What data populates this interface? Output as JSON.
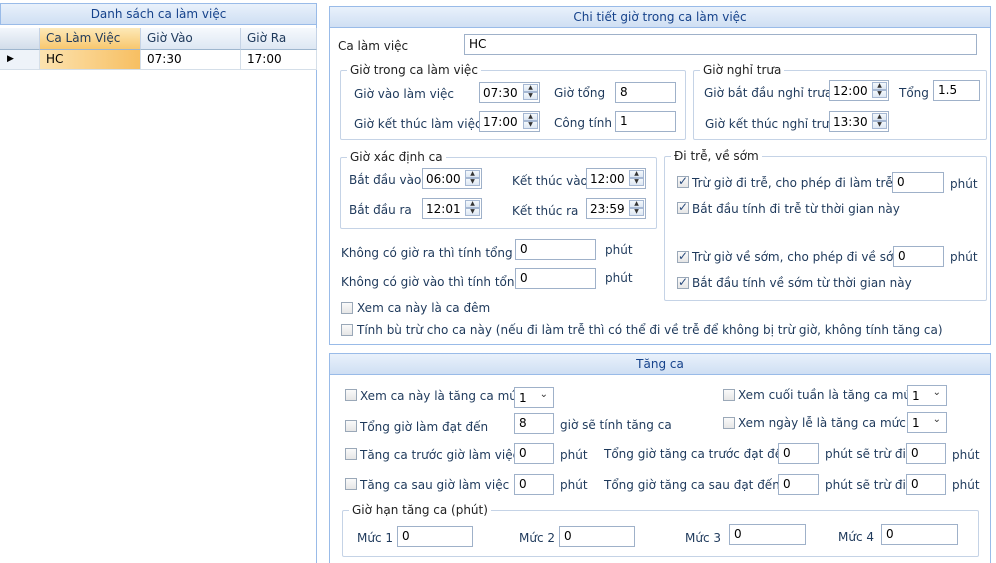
{
  "left_panel": {
    "title": "Danh sách ca làm việc",
    "columns": [
      "Ca Làm Việc",
      "Giờ Vào",
      "Giờ Ra"
    ],
    "rows": [
      {
        "ca": "HC",
        "vao": "07:30",
        "ra": "17:00"
      }
    ]
  },
  "detail": {
    "title": "Chi tiết giờ trong ca làm việc",
    "ca_label": "Ca làm việc",
    "ca_value": "HC",
    "work_hours": {
      "title": "Giờ trong ca làm việc",
      "start_label": "Giờ vào làm việc",
      "start_value": "07:30",
      "end_label": "Giờ kết thúc làm việc",
      "end_value": "17:00",
      "total_label": "Giờ tổng",
      "total_value": "8",
      "workday_label": "Công tính",
      "workday_value": "1"
    },
    "lunch": {
      "title": "Giờ nghỉ trưa",
      "start_label": "Giờ bắt đầu nghỉ trưa",
      "start_value": "12:00",
      "end_label": "Giờ kết thúc nghỉ trưa",
      "end_value": "13:30",
      "total_label": "Tổng",
      "total_value": "1.5"
    },
    "shift_detect": {
      "title": "Giờ xác định ca",
      "in_start_label": "Bắt đầu vào",
      "in_start_value": "06:00",
      "in_end_label": "Kết thúc vào",
      "in_end_value": "12:00",
      "out_start_label": "Bắt đầu ra",
      "out_start_value": "12:01",
      "out_end_label": "Kết thúc ra",
      "out_end_value": "23:59"
    },
    "no_out_label": "Không có giờ ra thì tính tổng",
    "no_out_value": "0",
    "no_in_label": "Không có giờ vào thì tính tổng",
    "no_in_value": "0",
    "minute_unit": "phút",
    "night_shift_label": "Xem ca này là ca đêm",
    "compensate_label": "Tính bù trừ cho ca này (nếu đi làm trễ thì có thể đi về trễ để không bị trừ giờ, không tính tăng ca)",
    "late_early": {
      "title": "Đi trễ, về sớm",
      "late_label": "Trừ giờ đi trễ, cho phép đi làm trễ",
      "late_value": "0",
      "late_from_label": "Bắt đầu tính đi trễ từ thời gian này",
      "early_label": "Trừ giờ về sớm, cho phép đi về sớm",
      "early_value": "0",
      "early_from_label": "Bắt đầu tính về sớm từ thời gian này",
      "unit": "phút"
    }
  },
  "overtime": {
    "title": "Tăng ca",
    "level_label": "Xem ca này là tăng ca mức",
    "level_value": "1",
    "weekend_label": "Xem cuối tuần là tăng ca mức",
    "weekend_value": "1",
    "total_label": "Tổng giờ làm đạt đến",
    "total_value": "8",
    "total_suffix": "giờ sẽ tính tăng ca",
    "holiday_label": "Xem ngày lễ là tăng ca mức",
    "holiday_value": "1",
    "before_label": "Tăng ca trước giờ làm việc",
    "before_value": "0",
    "before_total_label": "Tổng giờ tăng ca trước đạt đến",
    "before_total_value": "0",
    "before_deduct_label": "phút sẽ trừ đi",
    "before_deduct_value": "0",
    "after_label": "Tăng ca sau giờ làm việc",
    "after_value": "0",
    "after_total_label": "Tổng giờ tăng ca sau đạt đến",
    "after_total_value": "0",
    "after_deduct_label": "phút sẽ trừ đi",
    "after_deduct_value": "0",
    "unit": "phút",
    "limit": {
      "title": "Giờ hạn tăng ca (phút)",
      "levels": [
        {
          "label": "Mức 1",
          "value": "0"
        },
        {
          "label": "Mức 2",
          "value": "0"
        },
        {
          "label": "Mức 3",
          "value": "0"
        },
        {
          "label": "Mức 4",
          "value": "0"
        }
      ]
    }
  }
}
